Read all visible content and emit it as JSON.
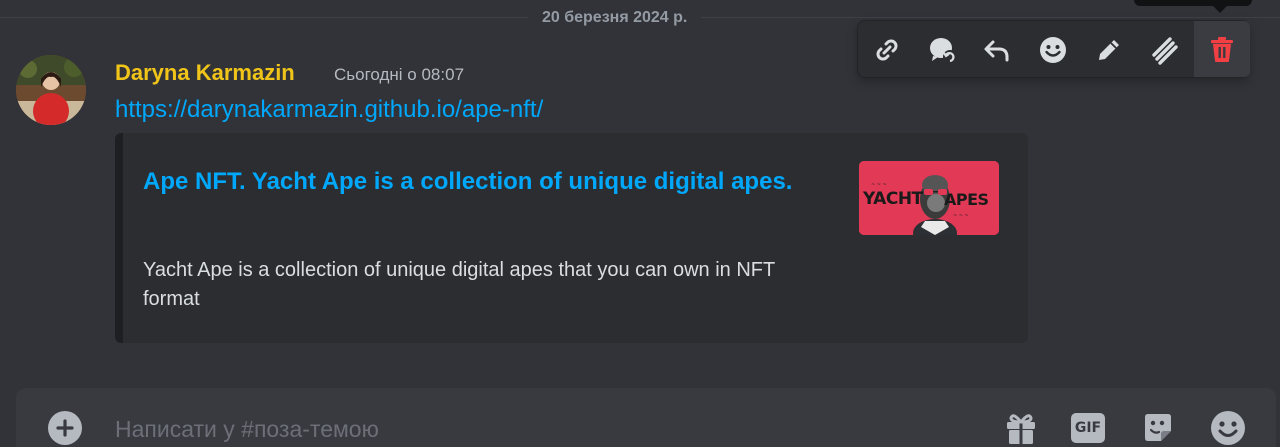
{
  "divider": {
    "date": "20 березня 2024 р."
  },
  "message": {
    "author": "Daryna Karmazin",
    "timestamp": "Сьогодні о 08:07",
    "link": "https://darynakarmazin.github.io/ape-nft/",
    "author_color": "#f0c419"
  },
  "embed": {
    "title": "Ape NFT. Yacht Ape is a collection of unique digital apes.",
    "description": "Yacht Ape is a collection of unique digital apes that you can own in NFT format",
    "thumbnail": {
      "yacht": "YACHT",
      "apes": "APES"
    },
    "title_color": "#00a8fc"
  },
  "toolbar": {
    "buttons": [
      "copy-link-icon",
      "create-thread-icon",
      "reply-icon",
      "add-reaction-icon",
      "edit-icon",
      "forward-icon",
      "delete-icon"
    ]
  },
  "composer": {
    "placeholder": "Написати у #поза-темою",
    "gif_label": "GIF"
  },
  "colors": {
    "background": "#313338",
    "accent_link": "#00a8fc",
    "danger": "#f23f43"
  }
}
